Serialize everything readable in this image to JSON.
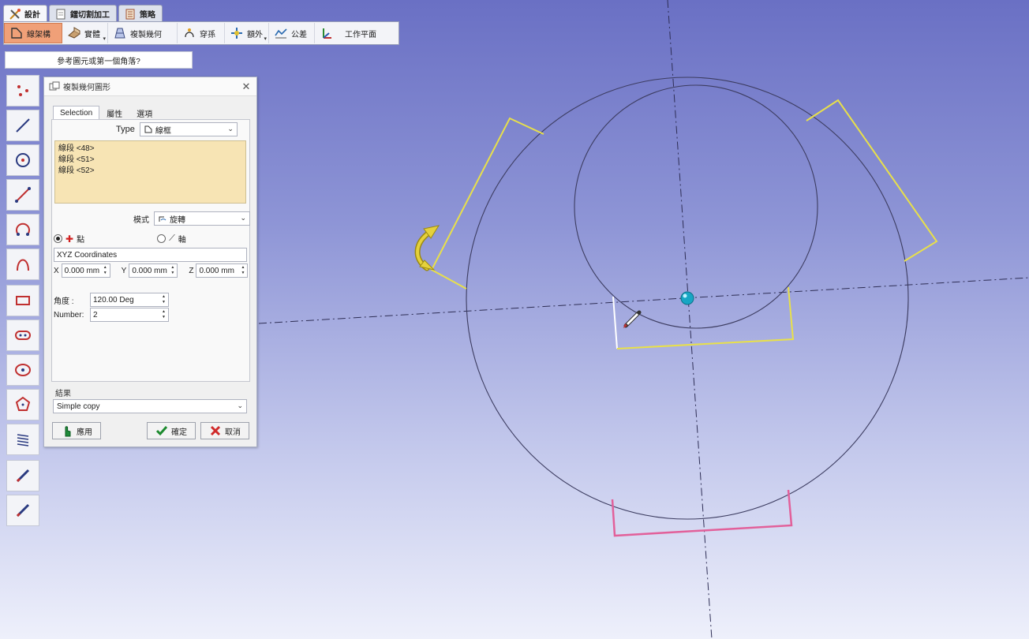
{
  "tabs": [
    {
      "label": "設計",
      "icon": "design-icon"
    },
    {
      "label": "鐳切割加工",
      "icon": "laser-cut-icon"
    },
    {
      "label": "策略",
      "icon": "strategy-icon"
    }
  ],
  "toolbar": {
    "items": [
      {
        "label": "線架構",
        "icon": "wireframe-icon"
      },
      {
        "label": "實體",
        "icon": "solid-icon"
      },
      {
        "label": "複製幾何",
        "icon": "copy-geometry-icon"
      },
      {
        "label": "穿孫",
        "icon": "pierce-icon"
      },
      {
        "label": "額外",
        "icon": "extra-icon"
      },
      {
        "label": "公差",
        "icon": "tolerance-icon"
      },
      {
        "label": "工作平面",
        "icon": "workplane-icon"
      }
    ]
  },
  "hint": "參考圖元或第一個角落?",
  "dialog": {
    "title": "複製幾何圖形",
    "tabs": [
      "Selection",
      "屬性",
      "選項"
    ],
    "type_label": "Type",
    "type_value": "線框",
    "selection": [
      "線段 <48>",
      "線段 <51>",
      "線段 <52>"
    ],
    "mode_label": "模式",
    "mode_value": "旋轉",
    "radio_point": "點",
    "radio_axis": "軸",
    "coord_system": "XYZ Coordinates",
    "x_label": "X",
    "x_value": "0.000 mm",
    "y_label": "Y",
    "y_value": "0.000 mm",
    "z_label": "Z",
    "z_value": "0.000 mm",
    "angle_label": "角度 :",
    "angle_value": "120.00 Deg",
    "number_label": "Number:",
    "number_value": "2",
    "result_label": "結果",
    "result_value": "Simple copy",
    "apply_label": "應用",
    "ok_label": "確定",
    "cancel_label": "取消"
  },
  "colors": {
    "viewport_top": "#6a70c4",
    "viewport_bottom": "#eef0fb",
    "selected_geometry": "#e8e04a",
    "preview_geometry": "#e2609a",
    "origin_marker": "#18a6c4",
    "active_tool": "#f0a078"
  }
}
